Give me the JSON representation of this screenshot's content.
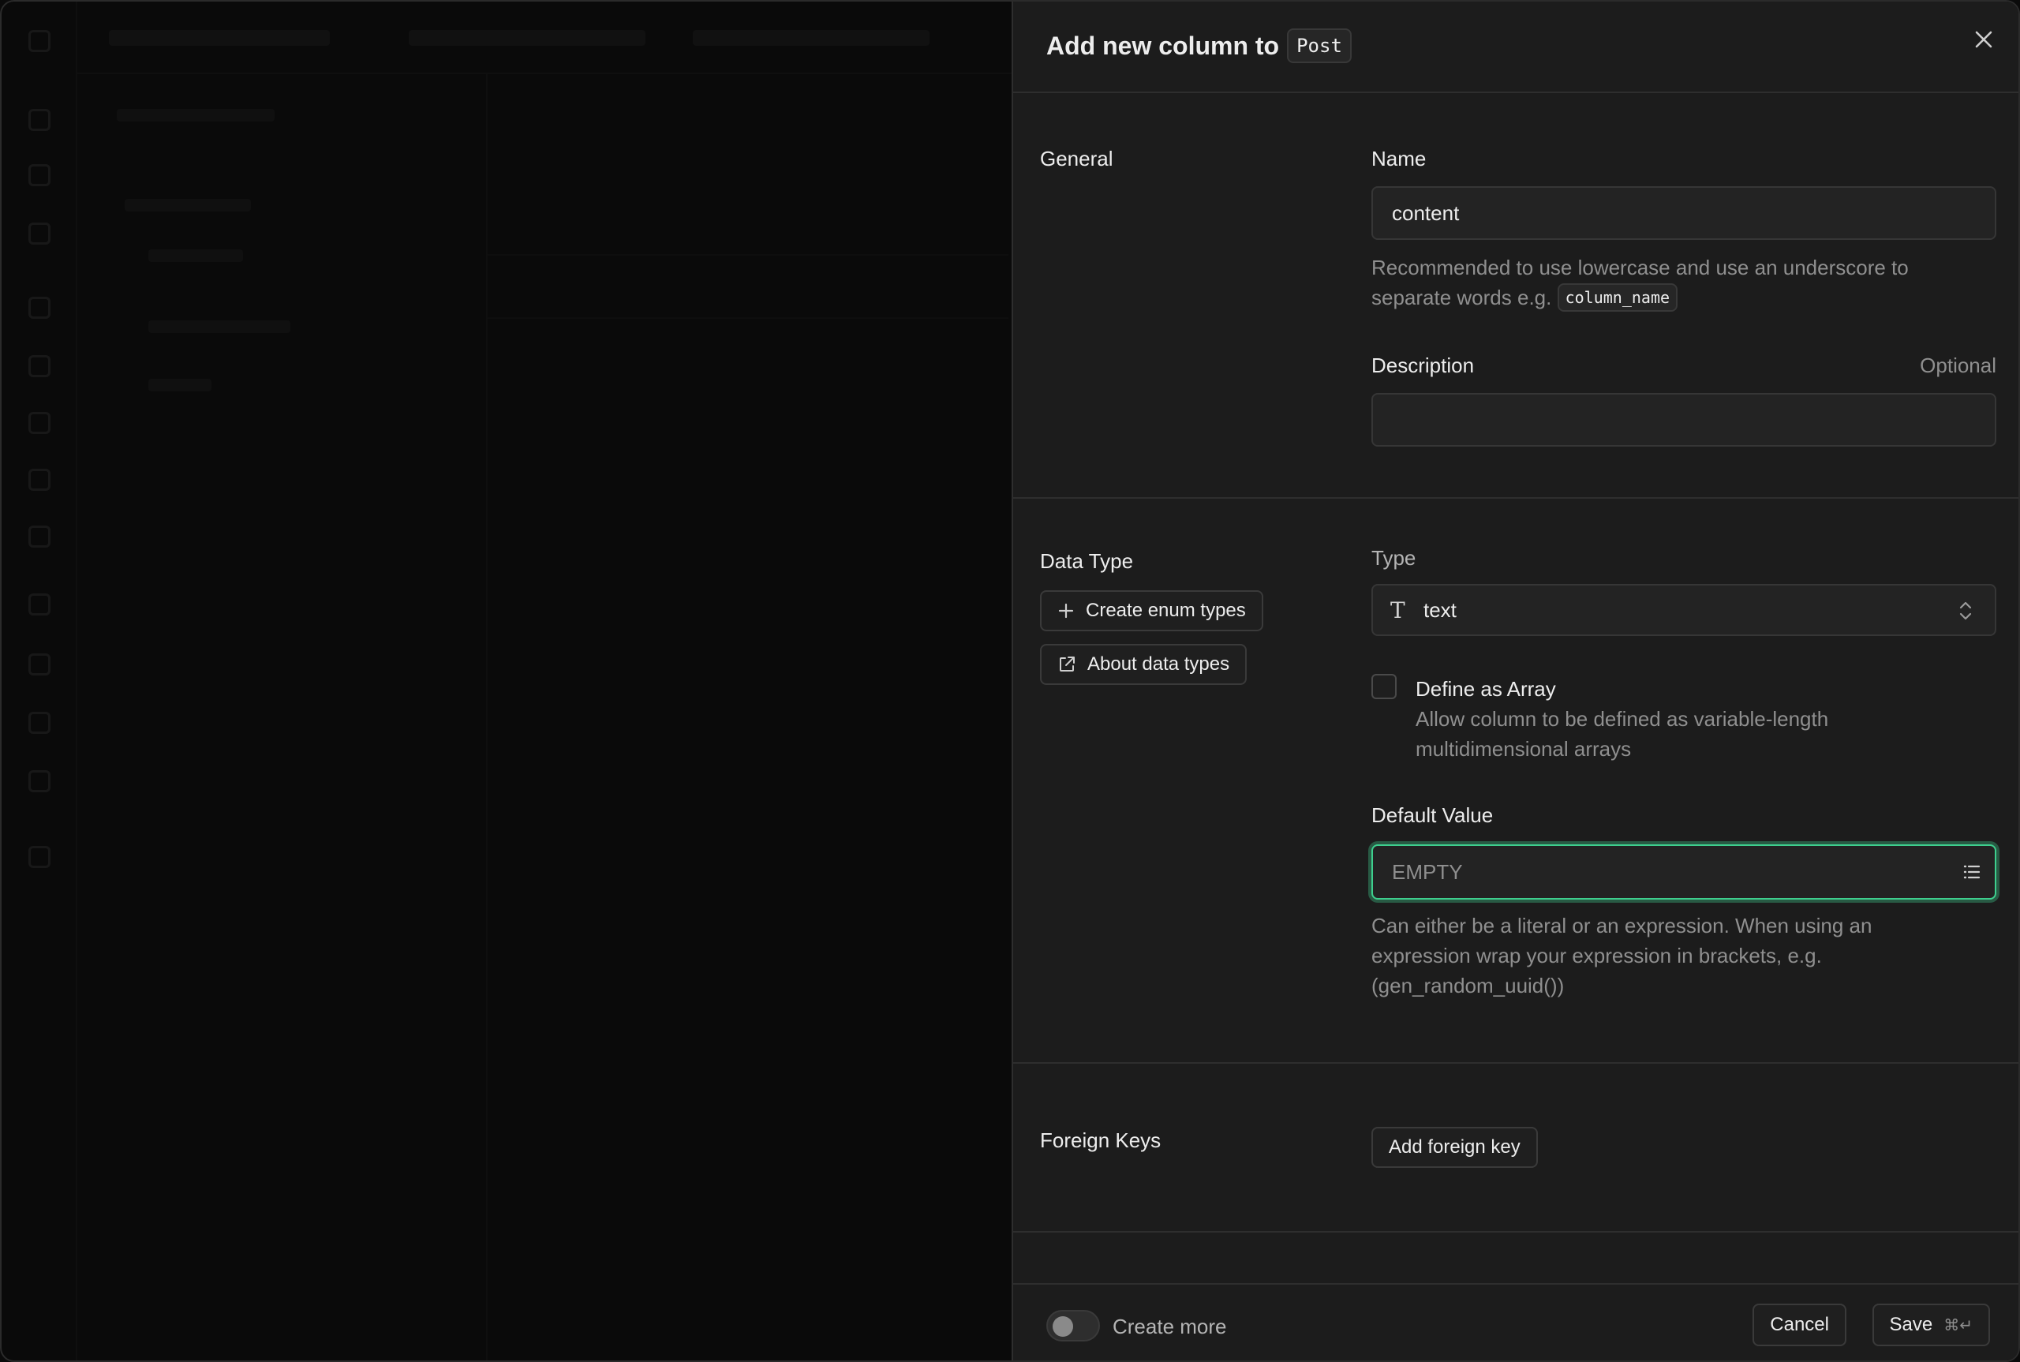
{
  "panel": {
    "title": "Add new column to",
    "table_name": "Post"
  },
  "general": {
    "section_label": "General",
    "name_label": "Name",
    "name_value": "content",
    "name_help": "Recommended to use lowercase and use an underscore to separate words e.g.",
    "name_help_example": "column_name",
    "description_label": "Description",
    "description_optional": "Optional",
    "description_value": ""
  },
  "data_type": {
    "section_label": "Data Type",
    "create_enum_label": "Create enum types",
    "about_types_label": "About data types",
    "type_label": "Type",
    "type_glyph": "T",
    "type_value": "text",
    "array_label": "Define as Array",
    "array_desc": "Allow column to be defined as variable-length multidimensional arrays",
    "default_label": "Default Value",
    "default_placeholder": "EMPTY",
    "default_help": "Can either be a literal or an expression. When using an expression wrap your expression in brackets, e.g. (gen_random_uuid())"
  },
  "foreign_keys": {
    "section_label": "Foreign Keys",
    "add_label": "Add foreign key"
  },
  "footer": {
    "create_more_label": "Create more",
    "create_more_on": false,
    "cancel_label": "Cancel",
    "save_label": "Save",
    "save_shortcut": "⌘↵"
  },
  "colors": {
    "accent": "#3ecf8e",
    "panel_bg": "#1c1c1c",
    "border": "#2e2e2e"
  }
}
